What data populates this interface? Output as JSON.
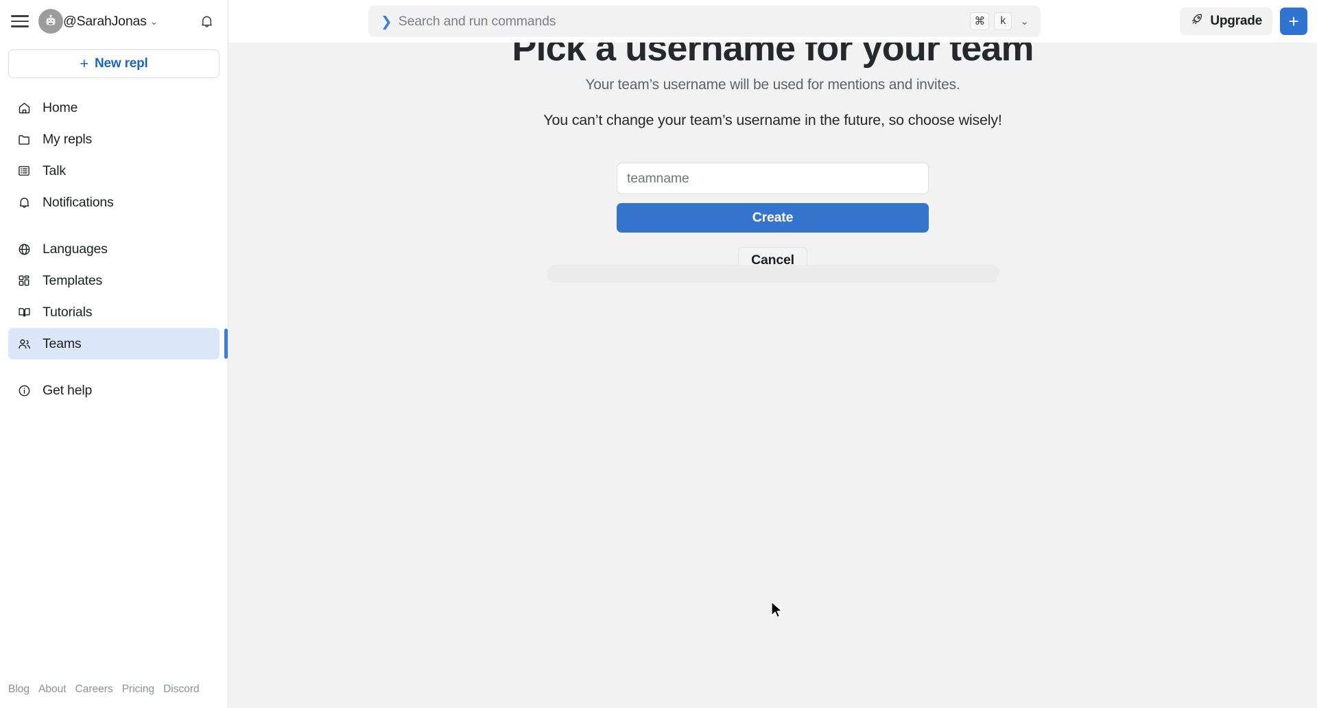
{
  "sidebar": {
    "hamburger_icon": "hamburger-menu-icon",
    "avatar_icon": "robot-avatar",
    "username": "@SarahJonas",
    "username_caret": "⌄",
    "bell_icon": "bell-icon",
    "new_repl": {
      "plus": "+",
      "label": "New repl"
    },
    "nav": [
      {
        "label": "Home",
        "icon": "home-icon",
        "active": false
      },
      {
        "label": "My repls",
        "icon": "folder-icon",
        "active": false
      },
      {
        "label": "Talk",
        "icon": "list-icon",
        "active": false
      },
      {
        "label": "Notifications",
        "icon": "bell-icon",
        "active": false
      },
      {
        "label": "Languages",
        "icon": "globe-icon",
        "active": false
      },
      {
        "label": "Templates",
        "icon": "grid-icon",
        "active": false
      },
      {
        "label": "Tutorials",
        "icon": "book-icon",
        "active": false
      },
      {
        "label": "Teams",
        "icon": "users-icon",
        "active": true
      },
      {
        "label": "Get help",
        "icon": "info-circle-icon",
        "active": false
      }
    ],
    "footer_links": [
      "Blog",
      "About",
      "Careers",
      "Pricing",
      "Discord"
    ]
  },
  "topbar": {
    "search": {
      "prefix": "❯",
      "placeholder": "Search and run commands",
      "keys": [
        "⌘",
        "k"
      ],
      "chevron": "⌄"
    },
    "upgrade_label": "Upgrade",
    "upgrade_icon": "rocket-icon",
    "new_button": "+"
  },
  "main": {
    "title": "Pick a username for your team",
    "subtitle": "Your team’s username will be used for mentions and invites.",
    "note": "You can’t change your team’s username in the future, so choose wisely!",
    "form": {
      "teamname_value": "",
      "teamname_placeholder": "teamname",
      "create_label": "Create",
      "cancel_label": "Cancel"
    }
  },
  "colors": {
    "accent_blue": "#3474cd",
    "active_nav_bg": "#dbe7f8",
    "active_nav_bar": "#3b7dd8",
    "link_blue": "#1b64c6",
    "page_bg": "#f2f2f2",
    "sidebar_bg": "#ffffff",
    "muted_text": "#8b9096"
  }
}
